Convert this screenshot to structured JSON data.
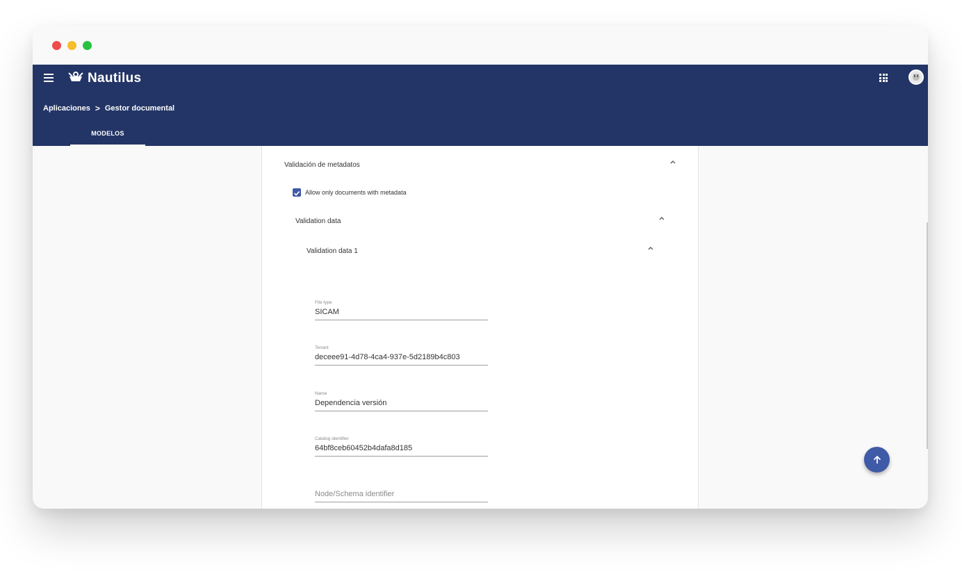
{
  "app": {
    "brand": "Nautilus"
  },
  "breadcrumb": {
    "items": [
      "Aplicaciones",
      "Gestor documental"
    ],
    "separator": ">"
  },
  "tabs": [
    {
      "label": "MODELOS",
      "active": true
    }
  ],
  "section": {
    "title": "Validación de metadatos",
    "checkbox": {
      "label": "Allow only documents with metadata",
      "checked": true
    },
    "validation_data": {
      "title": "Validation data",
      "item": {
        "title": "Validation data 1",
        "fields": [
          {
            "label": "File type",
            "value": "SICAM"
          },
          {
            "label": "Tenant",
            "value": "deceee91-4d78-4ca4-937e-5d2189b4c803"
          },
          {
            "label": "Name",
            "value": "Dependencia versión"
          },
          {
            "label": "Catalog identifier",
            "value": "64bf8ceb60452b4dafa8d185"
          },
          {
            "placeholder": "Node/Schema identifier"
          }
        ]
      }
    }
  },
  "colors": {
    "appbar": "#233566",
    "accent": "#3f5aa6"
  },
  "icons": [
    "menu-icon",
    "nautilus-logo-icon",
    "apps-grid-icon",
    "avatar",
    "chevron-up-icon",
    "check-icon",
    "arrow-up-icon"
  ]
}
